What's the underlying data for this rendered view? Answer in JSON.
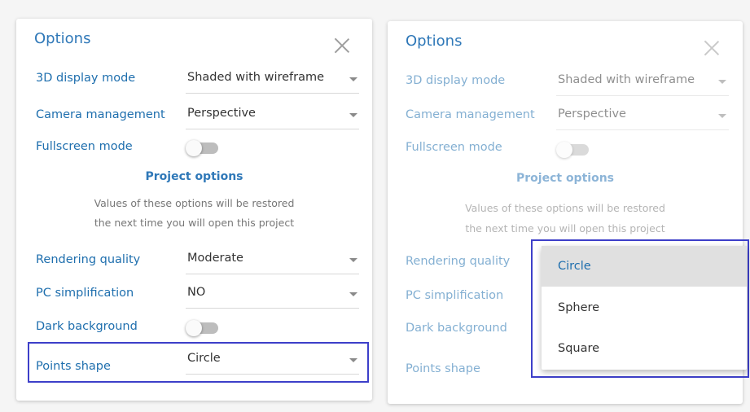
{
  "left_panel": {
    "title": "Options",
    "rows": {
      "display_mode": {
        "label": "3D display mode",
        "value": "Shaded with wireframe"
      },
      "camera": {
        "label": "Camera management",
        "value": "Perspective"
      },
      "fullscreen": {
        "label": "Fullscreen mode",
        "state": "off"
      },
      "rendering": {
        "label": "Rendering quality",
        "value": "Moderate"
      },
      "pc_simplification": {
        "label": "PC simplification",
        "value": "NO"
      },
      "dark_bg": {
        "label": "Dark background",
        "state": "off"
      },
      "points_shape": {
        "label": "Points shape",
        "value": "Circle"
      }
    },
    "project_options": {
      "title": "Project options",
      "desc_line1": "Values of these options will be restored",
      "desc_line2": "the next time you will open this project"
    }
  },
  "right_panel": {
    "title": "Options",
    "rows": {
      "display_mode": {
        "label": "3D display mode",
        "value": "Shaded with wireframe"
      },
      "camera": {
        "label": "Camera management",
        "value": "Perspective"
      },
      "fullscreen": {
        "label": "Fullscreen mode",
        "state": "off"
      },
      "rendering": {
        "label": "Rendering quality"
      },
      "pc_simplification": {
        "label": "PC simplification"
      },
      "dark_bg": {
        "label": "Dark background"
      },
      "points_shape": {
        "label": "Points shape"
      }
    },
    "project_options": {
      "title": "Project options",
      "desc_line1": "Values of these options will be restored",
      "desc_line2": "the next time you will open this project"
    }
  },
  "points_shape_menu": {
    "options": [
      "Circle",
      "Sphere",
      "Square"
    ],
    "selected": "Circle"
  },
  "colors": {
    "accent": "#2f78b8",
    "label": "#1f6fae",
    "highlight": "#3d3fc9"
  }
}
